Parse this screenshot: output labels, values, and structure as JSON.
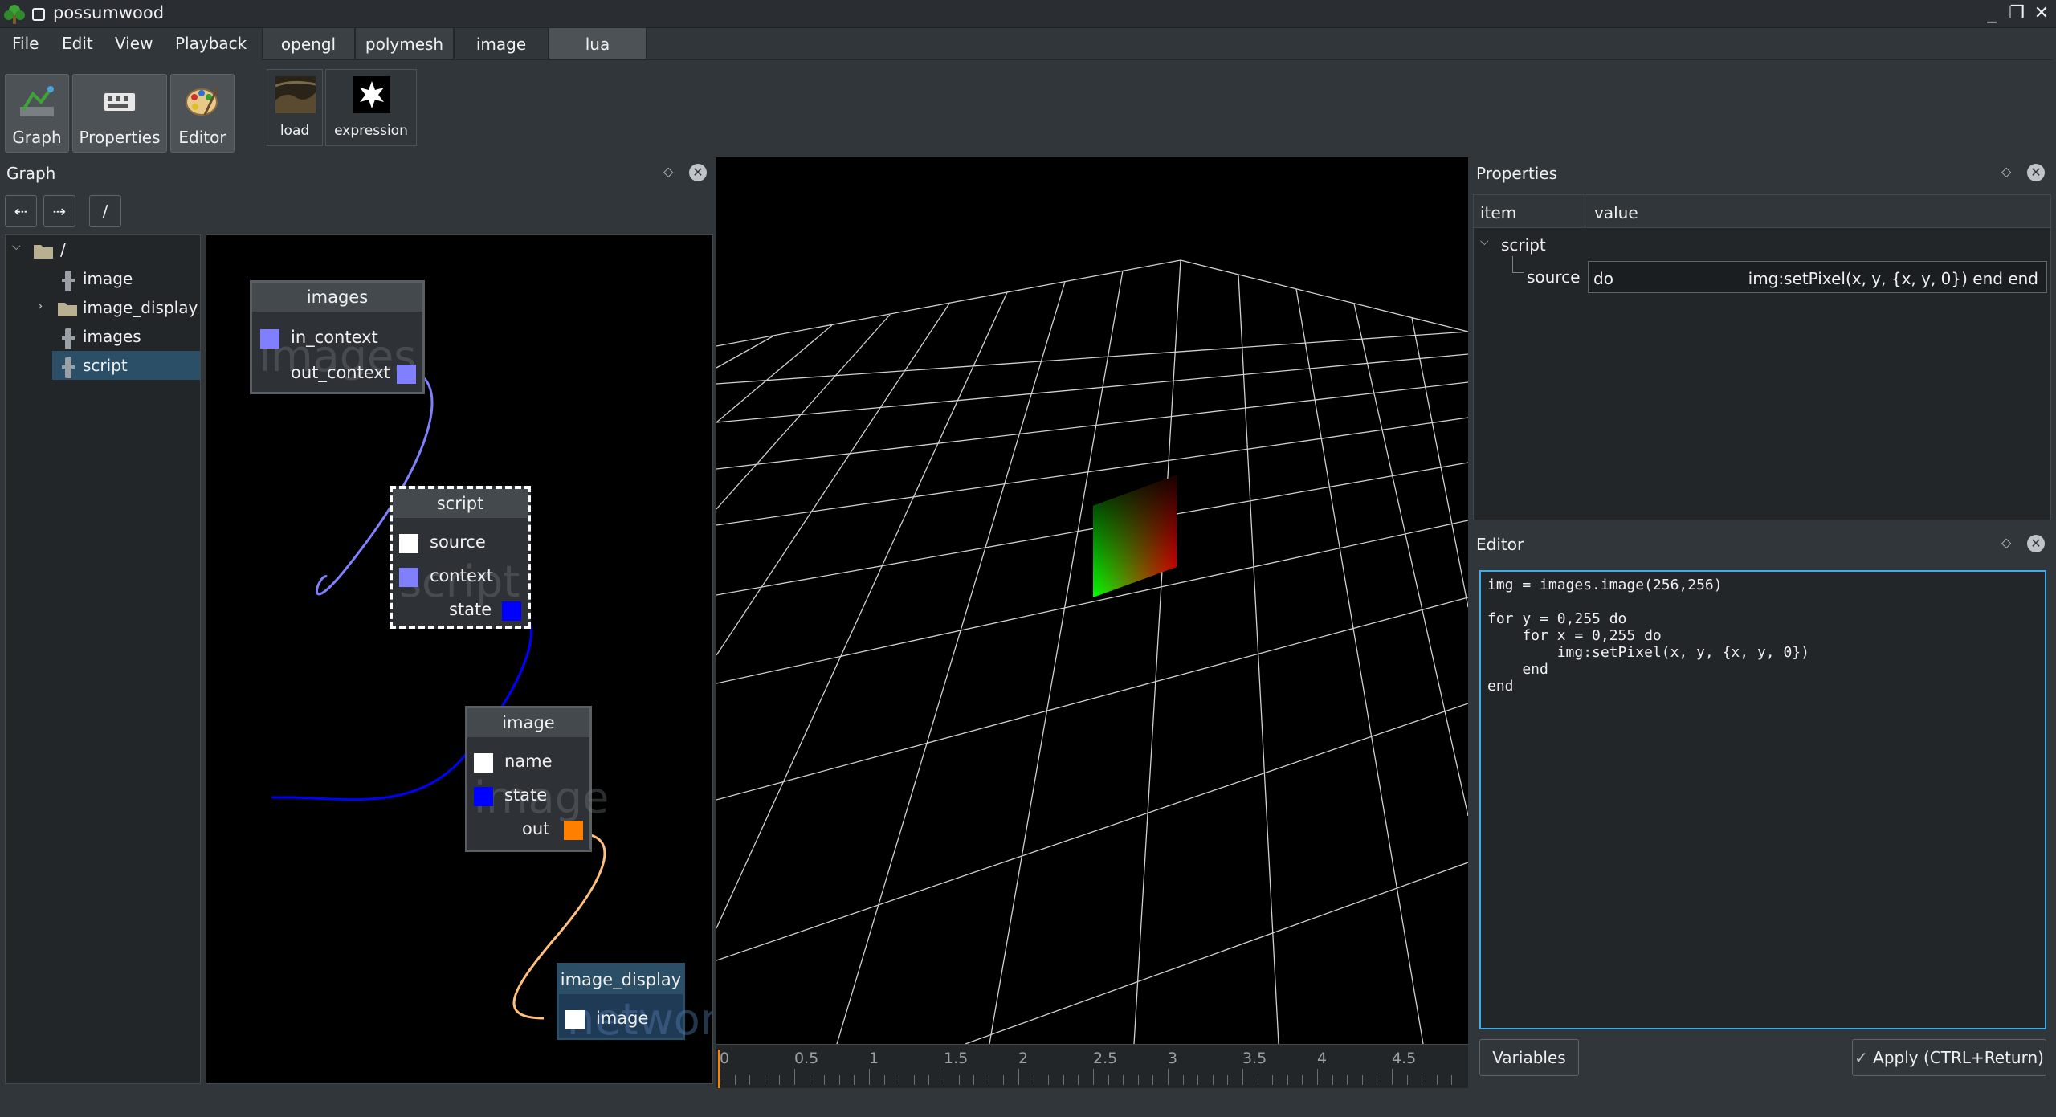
{
  "window": {
    "title": "possumwood",
    "minimize": "_",
    "maximize": "❐",
    "close": "✕"
  },
  "menu": [
    "File",
    "Edit",
    "View",
    "Playback"
  ],
  "tabs": [
    "opengl",
    "polymesh",
    "image",
    "lua"
  ],
  "toolbar": {
    "graph": "Graph",
    "properties": "Properties",
    "editor": "Editor"
  },
  "tab_tools": {
    "load": "load",
    "expression": "expression"
  },
  "graph_panel": {
    "title": "Graph",
    "path": "/",
    "tree": [
      {
        "label": "/",
        "type": "folder"
      },
      {
        "label": "image",
        "type": "node"
      },
      {
        "label": "image_display",
        "type": "folder"
      },
      {
        "label": "images",
        "type": "node"
      },
      {
        "label": "script",
        "type": "node",
        "selected": true
      }
    ],
    "nodes": {
      "images": {
        "title": "images",
        "ports": [
          "in_context",
          "out_context"
        ],
        "watermark": "images"
      },
      "script": {
        "title": "script",
        "ports": [
          "source",
          "context",
          "state"
        ],
        "watermark": "script"
      },
      "image": {
        "title": "image",
        "ports": [
          "name",
          "state",
          "out"
        ],
        "watermark": "image"
      },
      "image_display": {
        "title": "image_display",
        "ports": [
          "image"
        ],
        "watermark": "network"
      }
    }
  },
  "timeline": {
    "ticks": [
      "0",
      "0.5",
      "1",
      "1.5",
      "2",
      "2.5",
      "3",
      "3.5",
      "4",
      "4.5"
    ]
  },
  "properties_panel": {
    "title": "Properties",
    "columns": [
      "item",
      "value"
    ],
    "group": "script",
    "row_label": "source",
    "row_value_start": "do",
    "row_value_end": "img:setPixel(x, y, {x, y, 0})  end end"
  },
  "editor_panel": {
    "title": "Editor",
    "code": [
      "img = images.image(256,256)",
      "",
      "for y = 0,255 do",
      "    for x = 0,255 do",
      "        img:setPixel(x, y, {x, y, 0})",
      "    end",
      "end"
    ],
    "variables_button": "Variables",
    "apply_button": "Apply (CTRL+Return)"
  },
  "colors": {
    "background": "#31363b",
    "viewport": "#000000",
    "selection": "#2b4f66",
    "context_port": "#8080ff",
    "state_port": "#0000ff",
    "out_port": "#ff8000",
    "source_port": "#ffffff"
  }
}
